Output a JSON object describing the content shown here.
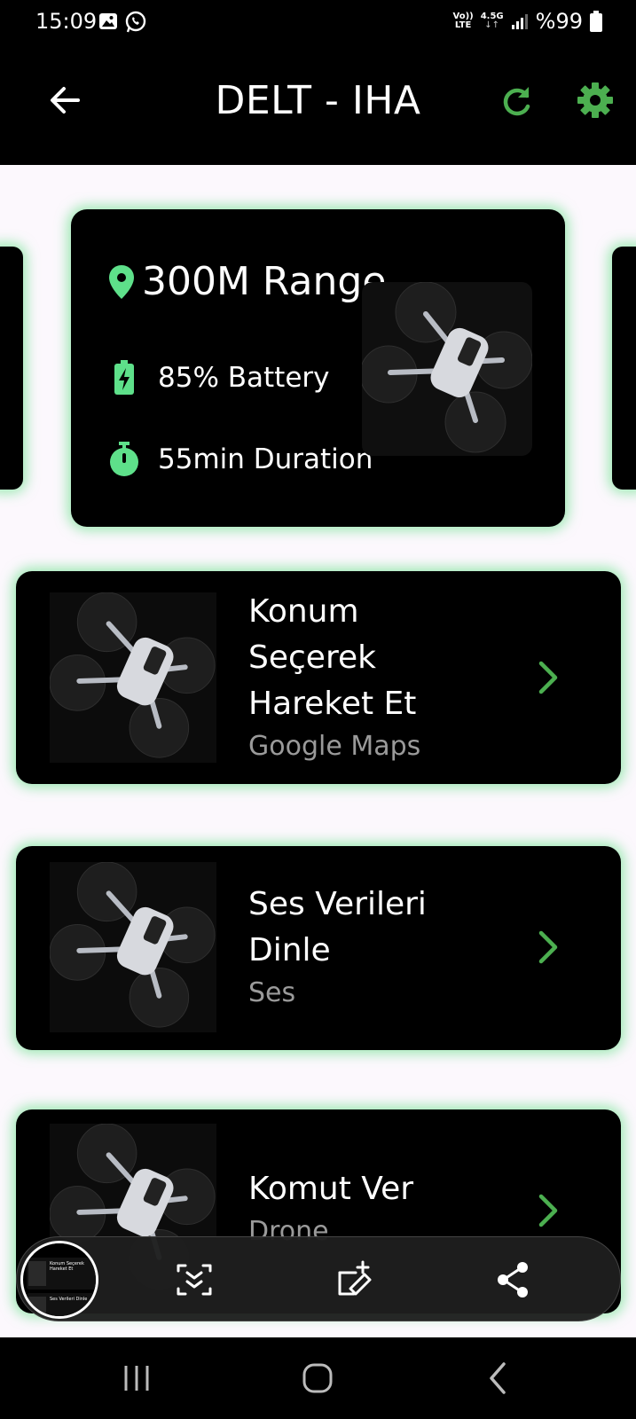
{
  "status_bar": {
    "time": "15:09",
    "network_top": "Vo))",
    "network_bottom": "LTE",
    "network_gen": "4.5G",
    "battery_text": "%99"
  },
  "app_bar": {
    "title": "DELT - IHA",
    "accent_color": "#4caf50"
  },
  "stats_card": {
    "range": "300M Range",
    "battery": "85% Battery",
    "duration": "55min Duration",
    "icon_color": "#5ee08a"
  },
  "actions": [
    {
      "title_lines": [
        "Konum",
        "Seçerek",
        "Hareket Et"
      ],
      "subtitle": "Google Maps"
    },
    {
      "title_lines": [
        "Ses Verileri",
        "Dinle"
      ],
      "subtitle": "Ses"
    },
    {
      "title_lines": [
        "Komut Ver"
      ],
      "subtitle": "Drone"
    }
  ],
  "screenshot_toolbar": {
    "preview_items": [
      "Konum Seçerek Hareket Et",
      "Ses Verileri Dinle"
    ]
  },
  "icons": {
    "back": "arrow-left-icon",
    "refresh": "refresh-icon",
    "settings": "gear-icon",
    "location": "location-pin-icon",
    "battery": "battery-charging-icon",
    "timer": "stopwatch-icon",
    "chevron": "chevron-right-icon"
  }
}
